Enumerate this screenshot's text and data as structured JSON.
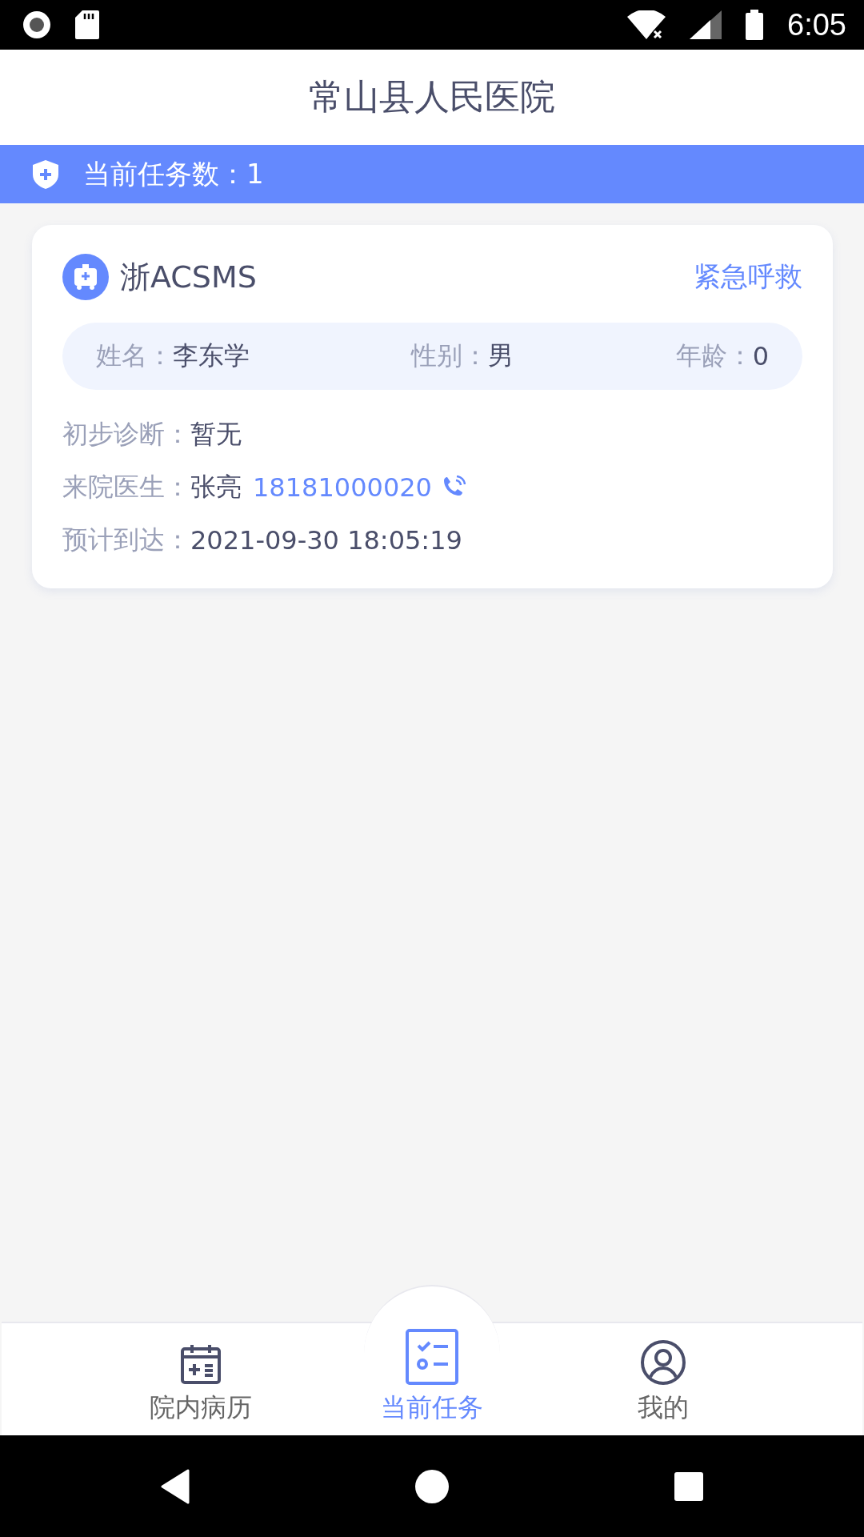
{
  "status_bar": {
    "time": "6:05"
  },
  "header": {
    "title": "常山县人民医院"
  },
  "task_bar": {
    "text": "当前任务数：1"
  },
  "tasks": [
    {
      "plate": "浙ACSMS",
      "action": "紧急呼救",
      "patient": [
        {
          "label": "姓名：",
          "value": "李东学"
        },
        {
          "label": "性别：",
          "value": "男"
        },
        {
          "label": "年龄：",
          "value": "0"
        }
      ],
      "details": [
        {
          "label": "初步诊断：",
          "value": "暂无"
        },
        {
          "label": "来院医生：",
          "value": "张亮",
          "phone": "18181000020"
        },
        {
          "label": "预计到达：",
          "value": "2021-09-30 18:05:19"
        }
      ]
    }
  ],
  "tabs": [
    {
      "label": "院内病历",
      "kind": "records",
      "selected": false
    },
    {
      "label": "当前任务",
      "kind": "tasks",
      "selected": true
    },
    {
      "label": "我的",
      "kind": "profile",
      "selected": false
    }
  ]
}
